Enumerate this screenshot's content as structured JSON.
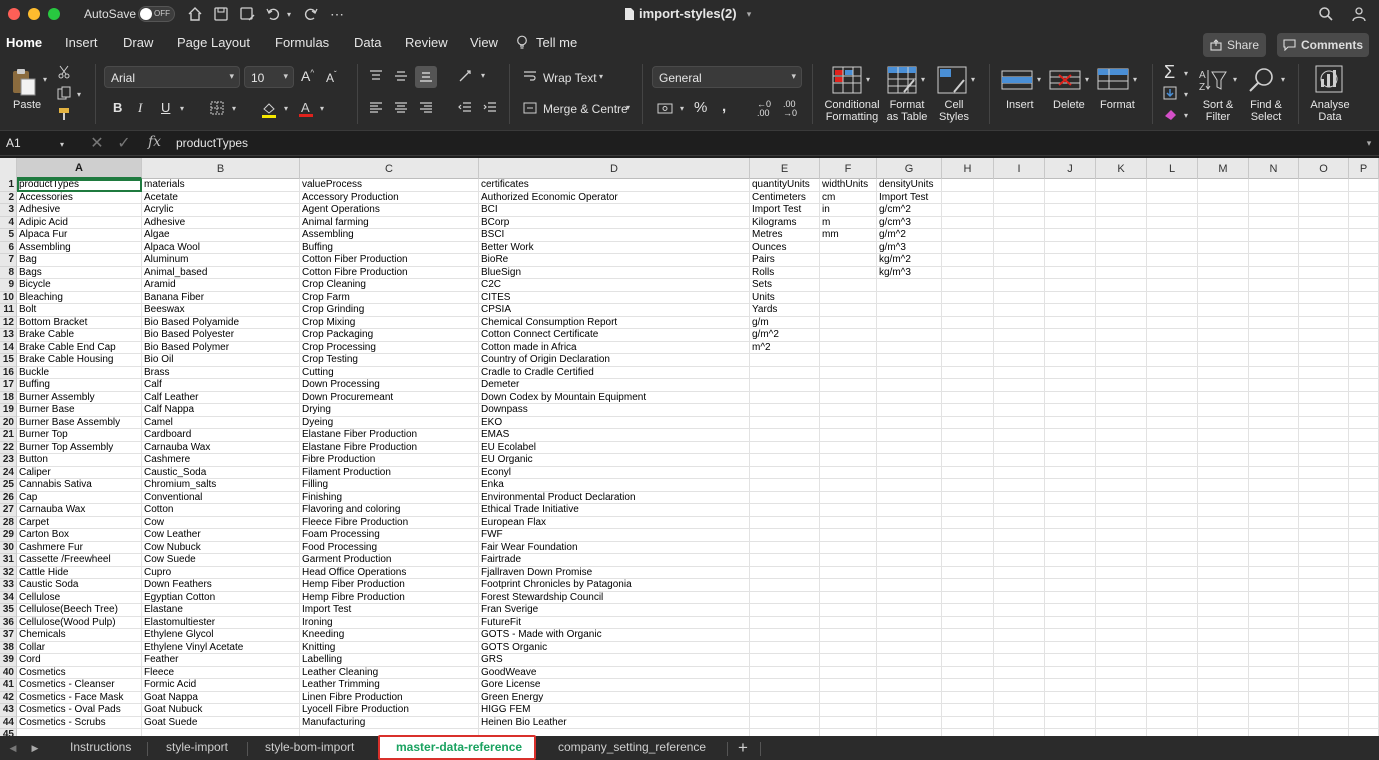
{
  "window": {
    "autosave_label": "AutoSave",
    "autosave_state": "OFF",
    "doc_title": "import-styles(2)"
  },
  "menu_tabs": [
    "Home",
    "Insert",
    "Draw",
    "Page Layout",
    "Formulas",
    "Data",
    "Review",
    "View",
    "Tell me"
  ],
  "share_label": "Share",
  "comments_label": "Comments",
  "ribbon": {
    "paste": "Paste",
    "font_name": "Arial",
    "font_size": "10",
    "wrap_text": "Wrap Text",
    "merge_centre": "Merge & Centre",
    "number_format": "General",
    "conditional_formatting": [
      "Conditional",
      "Formatting"
    ],
    "format_as_table": [
      "Format",
      "as Table"
    ],
    "cell_styles": [
      "Cell",
      "Styles"
    ],
    "insert": "Insert",
    "delete": "Delete",
    "format": "Format",
    "sort_filter": [
      "Sort &",
      "Filter"
    ],
    "find_select": [
      "Find &",
      "Select"
    ],
    "analyse_data": [
      "Analyse",
      "Data"
    ]
  },
  "formula_bar": {
    "cell_ref": "A1",
    "fx": "fx",
    "formula": "productTypes"
  },
  "columns": [
    "A",
    "B",
    "C",
    "D",
    "E",
    "F",
    "G",
    "H",
    "I",
    "J",
    "K",
    "L",
    "M",
    "N",
    "O",
    "P"
  ],
  "cells": [
    [
      "productTypes",
      "materials",
      "valueProcess",
      "certificates",
      "quantityUnits",
      "widthUnits",
      "densityUnits"
    ],
    [
      "Accessories",
      "Acetate",
      "Accessory Production",
      "Authorized Economic Operator",
      "Centimeters",
      "cm",
      "Import Test"
    ],
    [
      "Adhesive",
      "Acrylic",
      "Agent Operations",
      "BCI",
      "Import Test",
      "in",
      "g/cm^2"
    ],
    [
      "Adipic Acid",
      "Adhesive",
      "Animal farming",
      "BCorp",
      "Kilograms",
      "m",
      "g/cm^3"
    ],
    [
      "Alpaca Fur",
      "Algae",
      "Assembling",
      "BSCI",
      "Metres",
      "mm",
      "g/m^2"
    ],
    [
      "Assembling",
      "Alpaca Wool",
      "Buffing",
      "Better Work",
      "Ounces",
      "",
      "g/m^3"
    ],
    [
      "Bag",
      "Aluminum",
      "Cotton Fiber Production",
      "BioRe",
      "Pairs",
      "",
      "kg/m^2"
    ],
    [
      "Bags",
      "Animal_based",
      "Cotton Fibre Production",
      "BlueSign",
      "Rolls",
      "",
      "kg/m^3"
    ],
    [
      "Bicycle",
      "Aramid",
      "Crop Cleaning",
      "C2C",
      "Sets",
      "",
      ""
    ],
    [
      "Bleaching",
      "Banana Fiber",
      "Crop Farm",
      "CITES",
      "Units",
      "",
      ""
    ],
    [
      "Bolt",
      "Beeswax",
      "Crop Grinding",
      "CPSIA",
      "Yards",
      "",
      ""
    ],
    [
      "Bottom Bracket",
      "Bio Based Polyamide",
      "Crop Mixing",
      "Chemical Consumption Report",
      "g/m",
      "",
      ""
    ],
    [
      "Brake Cable",
      "Bio Based Polyester",
      "Crop Packaging",
      "Cotton Connect Certificate",
      "g/m^2",
      "",
      ""
    ],
    [
      "Brake Cable End Cap",
      "Bio Based Polymer",
      "Crop Processing",
      "Cotton made in Africa",
      "m^2",
      "",
      ""
    ],
    [
      "Brake Cable Housing",
      "Bio Oil",
      "Crop Testing",
      "Country of Origin Declaration",
      "",
      "",
      ""
    ],
    [
      "Buckle",
      "Brass",
      "Cutting",
      "Cradle to Cradle Certified",
      "",
      "",
      ""
    ],
    [
      "Buffing",
      "Calf",
      "Down Processing",
      "Demeter",
      "",
      "",
      ""
    ],
    [
      "Burner Assembly",
      "Calf Leather",
      "Down Procuremeant",
      "Down Codex by Mountain Equipment",
      "",
      "",
      ""
    ],
    [
      "Burner Base",
      "Calf Nappa",
      "Drying",
      "Downpass",
      "",
      "",
      ""
    ],
    [
      "Burner Base Assembly",
      "Camel",
      "Dyeing",
      "EKO",
      "",
      "",
      ""
    ],
    [
      "Burner Top",
      "Cardboard",
      "Elastane Fiber Production",
      "EMAS",
      "",
      "",
      ""
    ],
    [
      "Burner Top Assembly",
      "Carnauba Wax",
      "Elastane Fibre Production",
      "EU Ecolabel",
      "",
      "",
      ""
    ],
    [
      "Button",
      "Cashmere",
      "Fibre Production",
      "EU Organic",
      "",
      "",
      ""
    ],
    [
      "Caliper",
      "Caustic_Soda",
      "Filament Production",
      "Econyl",
      "",
      "",
      ""
    ],
    [
      "Cannabis Sativa",
      "Chromium_salts",
      "Filling",
      "Enka",
      "",
      "",
      ""
    ],
    [
      "Cap",
      "Conventional",
      "Finishing",
      "Environmental Product Declaration",
      "",
      "",
      ""
    ],
    [
      "Carnauba Wax",
      "Cotton",
      "Flavoring and coloring",
      "Ethical Trade Initiative",
      "",
      "",
      ""
    ],
    [
      "Carpet",
      "Cow",
      "Fleece Fibre Production",
      "European Flax",
      "",
      "",
      ""
    ],
    [
      "Carton Box",
      "Cow Leather",
      "Foam Processing",
      "FWF",
      "",
      "",
      ""
    ],
    [
      "Cashmere Fur",
      "Cow Nubuck",
      "Food Processing",
      "Fair Wear Foundation",
      "",
      "",
      ""
    ],
    [
      "Cassette /Freewheel",
      "Cow Suede",
      "Garment Production",
      "Fairtrade",
      "",
      "",
      ""
    ],
    [
      "Cattle Hide",
      "Cupro",
      "Head Office Operations",
      "Fjallraven Down Promise",
      "",
      "",
      ""
    ],
    [
      "Caustic Soda",
      "Down Feathers",
      "Hemp Fiber Production",
      "Footprint Chronicles by Patagonia",
      "",
      "",
      ""
    ],
    [
      "Cellulose",
      "Egyptian Cotton",
      "Hemp Fibre Production",
      "Forest Stewardship Council",
      "",
      "",
      ""
    ],
    [
      "Cellulose(Beech Tree)",
      "Elastane",
      "Import Test",
      "Fran Sverige",
      "",
      "",
      ""
    ],
    [
      "Cellulose(Wood Pulp)",
      "Elastomultiester",
      "Ironing",
      "FutureFit",
      "",
      "",
      ""
    ],
    [
      "Chemicals",
      "Ethylene Glycol",
      "Kneeding",
      "GOTS - Made with Organic",
      "",
      "",
      ""
    ],
    [
      "Collar",
      "Ethylene Vinyl Acetate",
      "Knitting",
      "GOTS Organic",
      "",
      "",
      ""
    ],
    [
      "Cord",
      "Feather",
      "Labelling",
      "GRS",
      "",
      "",
      ""
    ],
    [
      "Cosmetics",
      "Fleece",
      "Leather Cleaning",
      "GoodWeave",
      "",
      "",
      ""
    ],
    [
      "Cosmetics - Cleanser",
      "Formic Acid",
      "Leather Trimming",
      "Gore License",
      "",
      "",
      ""
    ],
    [
      "Cosmetics - Face Mask",
      "Goat Nappa",
      "Linen Fibre Production",
      "Green Energy",
      "",
      "",
      ""
    ],
    [
      "Cosmetics - Oval Pads",
      "Goat Nubuck",
      "Lyocell Fibre Production",
      "HIGG FEM",
      "",
      "",
      ""
    ],
    [
      "Cosmetics - Scrubs",
      "Goat Suede",
      "Manufacturing",
      "Heinen Bio Leather",
      "",
      "",
      ""
    ]
  ],
  "sheet_tabs": [
    "Instructions",
    "style-import",
    "style-bom-import",
    "master-data-reference",
    "company_setting_reference"
  ],
  "add_sheet": "+"
}
